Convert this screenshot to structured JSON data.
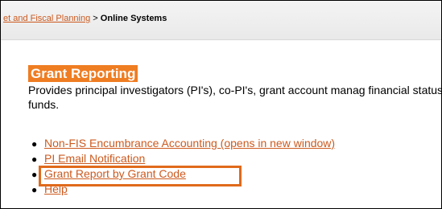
{
  "breadcrumb": {
    "parent_label": "et and Fiscal Planning",
    "separator": ">",
    "current_label": "Online Systems"
  },
  "section": {
    "title": "Grant Reporting",
    "description": "Provides principal investigators (PI's), co-PI's, grant account manag financial status of grant funds."
  },
  "links": [
    {
      "label": "Non-FIS Encumbrance Accounting (opens in new window)"
    },
    {
      "label": "PI Email Notification"
    },
    {
      "label": "Grant Report by Grant Code"
    },
    {
      "label": "Help"
    }
  ],
  "colors": {
    "accent_orange": "#ef7d22",
    "link_color": "#cc5a1f",
    "highlight_border": "#e06a1b"
  }
}
